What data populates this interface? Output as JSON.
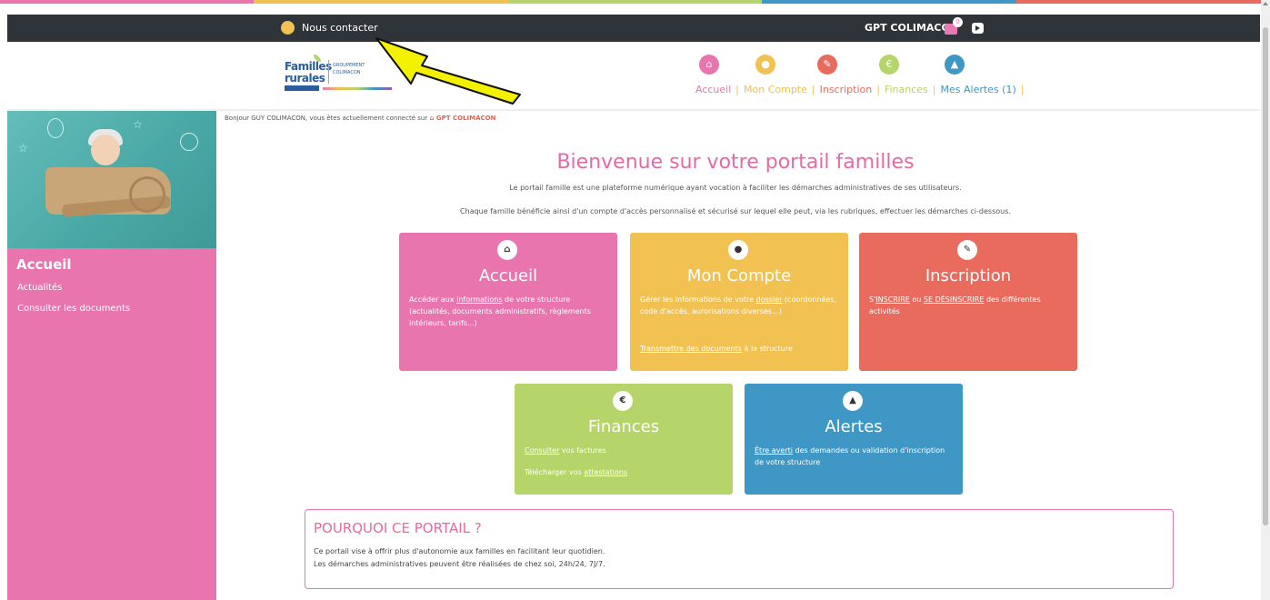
{
  "colors": {
    "pink": "#e875ae",
    "yellow": "#f1c152",
    "red": "#e96b5e",
    "green": "#b5d46a",
    "blue": "#3e97c4",
    "dark": "#2f3439"
  },
  "topbar": {
    "contact_label": "Nous contacter",
    "user_label": "GPT COLIMACON",
    "cart_badge": "0"
  },
  "logo": {
    "line1": "Familles",
    "line2": "rurales",
    "group1": "GROUPEMENT",
    "group2": "COLIMACON"
  },
  "nav": {
    "items": [
      {
        "label": "Accueil",
        "icon": "home-icon",
        "glyph": "⌂",
        "color": "#e875ae"
      },
      {
        "label": "Mon Compte",
        "icon": "user-icon",
        "glyph": "●",
        "color": "#f1c152"
      },
      {
        "label": "Inscription",
        "icon": "pencil-icon",
        "glyph": "✎",
        "color": "#e96b5e"
      },
      {
        "label": "Finances",
        "icon": "euro-icon",
        "glyph": "€",
        "color": "#b5d46a"
      },
      {
        "label": "Mes Alertes (1)",
        "icon": "warning-icon",
        "glyph": "▲",
        "color": "#3e97c4"
      }
    ]
  },
  "sidebar": {
    "title": "Accueil",
    "items": [
      "Actualités",
      "Consulter les documents"
    ]
  },
  "breadcrumb": {
    "prefix": "Bonjour GUY COLIMACON, vous êtes actuellement connecté sur",
    "strong": "⌂ GPT COLIMACON"
  },
  "main": {
    "welcome": "Bienvenue sur votre portail familles",
    "intro1": "Le portail famille est une plateforme numérique ayant vocation à faciliter les démarches administratives de ses utilisateurs.",
    "intro2": "Chaque famille bénéficie ainsi d'un compte d'accès personnalisé et sécurisé sur lequel elle peut, via les rubriques, effectuer les démarches ci-dessous."
  },
  "cards": {
    "accueil": {
      "title": "Accueil",
      "glyph": "⌂",
      "text_pre": "Accéder aux ",
      "link": "informations",
      "text_post": " de votre structure (actualités, documents administratifs, règlements intérieurs, tarifs...)"
    },
    "compte": {
      "title": "Mon Compte",
      "glyph": "●",
      "text_pre": "Gérer les informations de votre ",
      "link": "dossier",
      "text_post": " (coordonnées, code d'accès, aurorisations diverses...)",
      "text2_link": "Transmettre des documents",
      "text2_post": " à la structure"
    },
    "inscription": {
      "title": "Inscription",
      "glyph": "✎",
      "text_pre": "S'",
      "link": "INSCRIRE",
      "text_mid": " ou ",
      "link2": "SE DÉSINSCRIRE",
      "text_post": " des différentes activités"
    },
    "finances": {
      "title": "Finances",
      "glyph": "€",
      "link": "Consulter",
      "text_post": " vos factures",
      "text2_pre": "Télécharger vos ",
      "text2_link": "attestations"
    },
    "alertes": {
      "title": "Alertes",
      "glyph": "▲",
      "link": "Être averti",
      "text_post": " des demandes ou validation d'inscription de votre structure"
    }
  },
  "why": {
    "title": "POURQUOI CE PORTAIL ?",
    "p1": "Ce portail vise à offrir plus d'autonomie aux familles en facilitant leur quotidien.",
    "p2": "Les démarches administratives peuvent être réalisées de chez soi, 24h/24, 7J/7."
  }
}
